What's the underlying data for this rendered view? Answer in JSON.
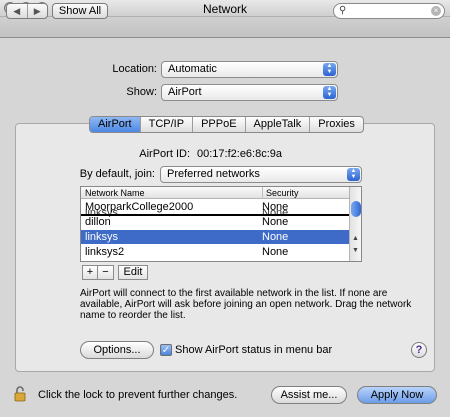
{
  "window": {
    "title": "Network"
  },
  "toolbar": {
    "back_glyph": "◀",
    "forward_glyph": "▶",
    "show_all_label": "Show All",
    "search": {
      "value": "",
      "placeholder": ""
    }
  },
  "location": {
    "label": "Location:",
    "value": "Automatic"
  },
  "show": {
    "label": "Show:",
    "value": "AirPort"
  },
  "tabs": [
    {
      "label": "AirPort",
      "active": true
    },
    {
      "label": "TCP/IP"
    },
    {
      "label": "PPPoE"
    },
    {
      "label": "AppleTalk"
    },
    {
      "label": "Proxies"
    }
  ],
  "airport": {
    "id_label": "AirPort ID:",
    "id_value": "00:17:f2:e6:8c:9a",
    "join_label": "By default, join:",
    "join_value": "Preferred networks"
  },
  "table": {
    "columns": [
      "Network Name",
      "Security"
    ],
    "rows": [
      {
        "name": "MoorparkCollege2000",
        "security": "None"
      },
      {
        "name": "linksys",
        "security": "None",
        "ghost": true
      },
      {
        "name": "dillon",
        "security": "None"
      },
      {
        "name": "linksys",
        "security": "None",
        "selected": true
      },
      {
        "name": "linksys2",
        "security": "None"
      }
    ]
  },
  "list_buttons": {
    "add": "+",
    "remove": "−",
    "edit": "Edit"
  },
  "hint": "AirPort will connect to the first available network in the list. If none are available, AirPort will ask before joining an open network. Drag the network name to reorder the list.",
  "options_label": "Options...",
  "status_checkbox": {
    "label": "Show AirPort status in menu bar",
    "checked": true
  },
  "help_label": "?",
  "lock_text": "Click the lock to prevent further changes.",
  "assist_label": "Assist me...",
  "apply_label": "Apply Now",
  "colors": {
    "selection": "#3d6bc7",
    "accent": "#4e88e4"
  }
}
